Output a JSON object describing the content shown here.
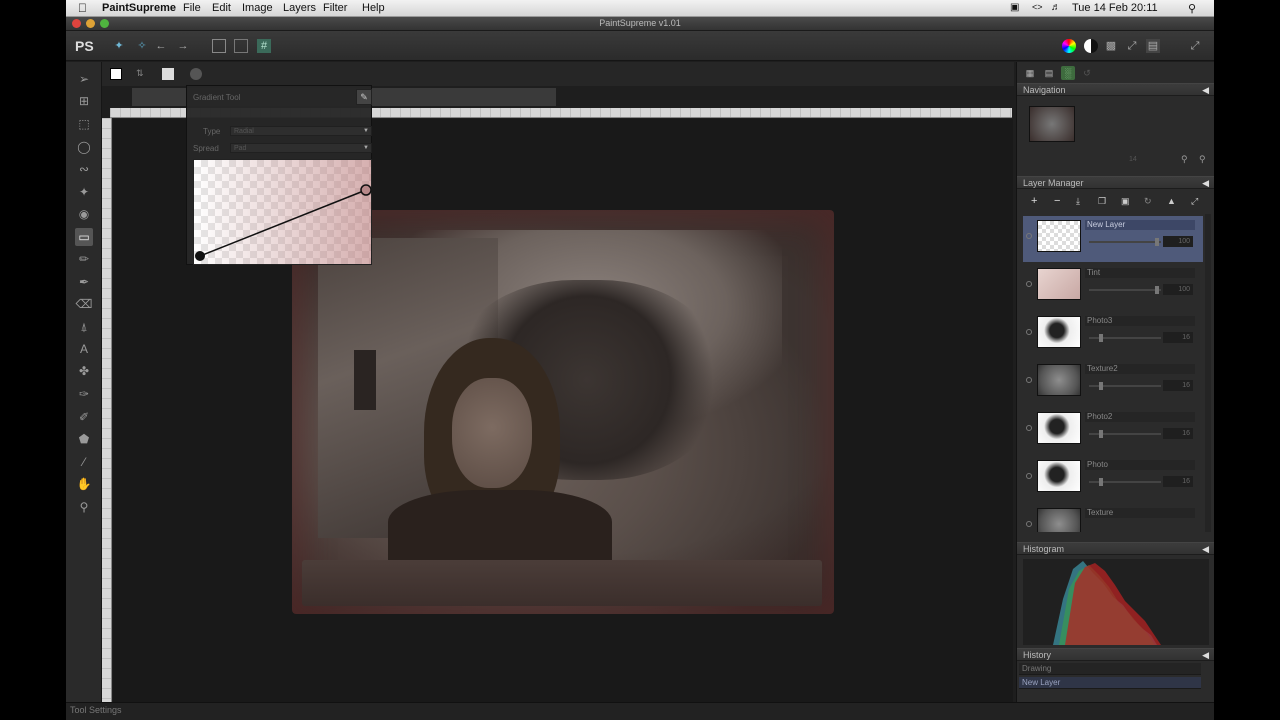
{
  "menubar": {
    "app_name": "PaintSupreme",
    "items": [
      "File",
      "Edit",
      "Image",
      "Layers",
      "Filter",
      "Help"
    ],
    "clock": "Tue 14 Feb  20:11"
  },
  "window": {
    "title": "PaintSupreme v1.01"
  },
  "toolbar": {
    "logo": "PS"
  },
  "gradient_tool": {
    "title": "Gradient Tool",
    "type_label": "Type",
    "type_value": "Radial",
    "spread_label": "Spread",
    "spread_value": "Pad"
  },
  "panels": {
    "navigation": "Navigation",
    "layer_manager": "Layer Manager",
    "histogram": "Histogram",
    "history": "History"
  },
  "layers": [
    {
      "name": "New Layer",
      "opacity": "100",
      "thumb": "checker"
    },
    {
      "name": "Tint",
      "opacity": "100",
      "thumb": "tint"
    },
    {
      "name": "Photo3",
      "opacity": "16",
      "thumb": "photo"
    },
    {
      "name": "Texture2",
      "opacity": "16",
      "thumb": "texture"
    },
    {
      "name": "Photo2",
      "opacity": "16",
      "thumb": "photo"
    },
    {
      "name": "Photo",
      "opacity": "16",
      "thumb": "photo"
    },
    {
      "name": "Texture",
      "opacity": "",
      "thumb": "texture"
    }
  ],
  "history": [
    "Drawing",
    "New Layer"
  ],
  "navigation": {
    "zoom": "14"
  },
  "status": {
    "tool_settings": "Tool Settings"
  },
  "icons": {
    "apple": "apple-icon",
    "add": "plus-icon",
    "remove": "minus-icon"
  },
  "colors": {
    "selection": "#4f5a7a",
    "background": "#1e1e1e",
    "panel": "#2b2b2b"
  }
}
